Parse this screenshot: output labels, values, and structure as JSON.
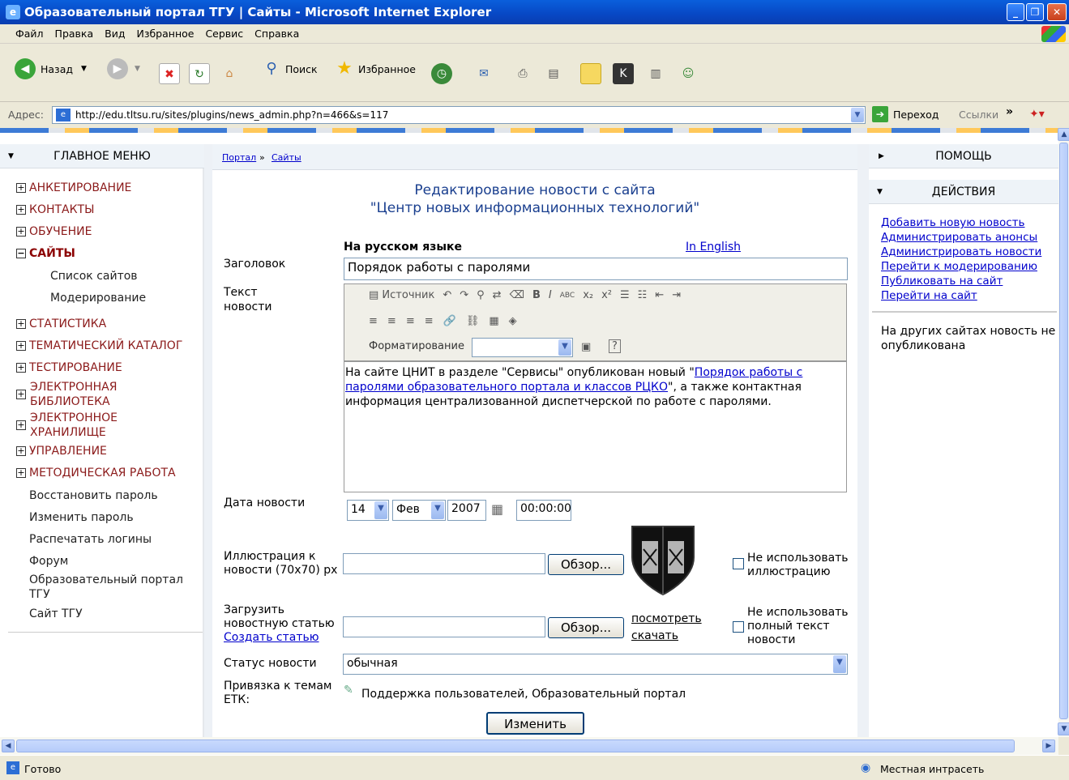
{
  "window": {
    "title": "Образовательный портал ТГУ | Сайты - Microsoft Internet Explorer"
  },
  "menubar": [
    "Файл",
    "Правка",
    "Вид",
    "Избранное",
    "Сервис",
    "Справка"
  ],
  "toolbar": {
    "back": "Назад",
    "search": "Поиск",
    "favorites": "Избранное"
  },
  "address": {
    "label": "Адрес:",
    "url": "http://edu.tltsu.ru/sites/plugins/news_admin.php?n=466&s=117",
    "go": "Переход",
    "links": "Ссылки"
  },
  "left_panel": {
    "title": "ГЛАВНОЕ МЕНЮ",
    "items": [
      "АНКЕТИРОВАНИЕ",
      "КОНТАКТЫ",
      "ОБУЧЕНИЕ",
      "САЙТЫ",
      "СТАТИСТИКА",
      "ТЕМАТИЧЕСКИЙ КАТАЛОГ",
      "ТЕСТИРОВАНИЕ",
      "ЭЛЕКТРОННАЯ",
      "БИБЛИОТЕКА",
      "ЭЛЕКТРОННОЕ",
      "ХРАНИЛИЩЕ",
      "УПРАВЛЕНИЕ",
      "МЕТОДИЧЕСКАЯ РАБОТА"
    ],
    "sub_items": [
      "Список сайтов",
      "Модерирование"
    ],
    "links": [
      "Восстановить пароль",
      "Изменить пароль",
      "Распечатать логины",
      "Форум",
      "Образовательный портал",
      "ТГУ",
      "Сайт ТГУ"
    ]
  },
  "breadcrumb": {
    "portal": "Портал",
    "sep": "»",
    "sites": "Сайты"
  },
  "form": {
    "title_line1": "Редактирование новости с сайта",
    "title_line2": "\"Центр новых информационных технологий\"",
    "lang_ru": "На русском языке",
    "lang_en": "In English",
    "headline_label": "Заголовок",
    "headline_value": "Порядок работы с паролями",
    "text_label_1": "Текст",
    "text_label_2": "новости",
    "editor_source": "Источник",
    "editor_format": "Форматирование",
    "body_before": "На сайте ЦНИТ в разделе \"Сервисы\" опубликован новый \"",
    "body_link_1": "Порядок работы с",
    "body_link_2": "паролями образовательного портала и классов РЦКО",
    "body_after_1": "\", а также контактная",
    "body_after_2": "информация централизованной диспетчерской по работе с паролями.",
    "date_label": "Дата новости",
    "date_day": "14",
    "date_month": "Фев",
    "date_year": "2007",
    "date_time": "00:00:00",
    "illus_label_1": "Иллюстрация к",
    "illus_label_2": "новости (70x70) px",
    "browse": "Обзор...",
    "no_illus_1": "Не использовать",
    "no_illus_2": "иллюстрацию",
    "upload_label_1": "Загрузить",
    "upload_label_2": "новостную статью",
    "create_article": "Создать статью",
    "view": "посмотреть",
    "download": "скачать",
    "no_full_1": "Не использовать",
    "no_full_2": "полный текст",
    "no_full_3": "новости",
    "status_label": "Статус новости",
    "status_value": "обычная",
    "etk_label_1": "Привязка к темам",
    "etk_label_2": "ЕТК:",
    "etk_value": "Поддержка пользователей, Образовательный портал",
    "submit": "Изменить"
  },
  "right_panel": {
    "help": "ПОМОЩЬ",
    "actions": "ДЕЙСТВИЯ",
    "links": [
      "Добавить новую новость",
      "Администрировать анонсы",
      "Администрировать новости",
      "Перейти к модерированию",
      "Публиковать на сайт",
      "Перейти на сайт"
    ],
    "note_1": "На других сайтах новость не",
    "note_2": "опубликована"
  },
  "status": {
    "left": "Готово",
    "right": "Местная интрасеть"
  }
}
